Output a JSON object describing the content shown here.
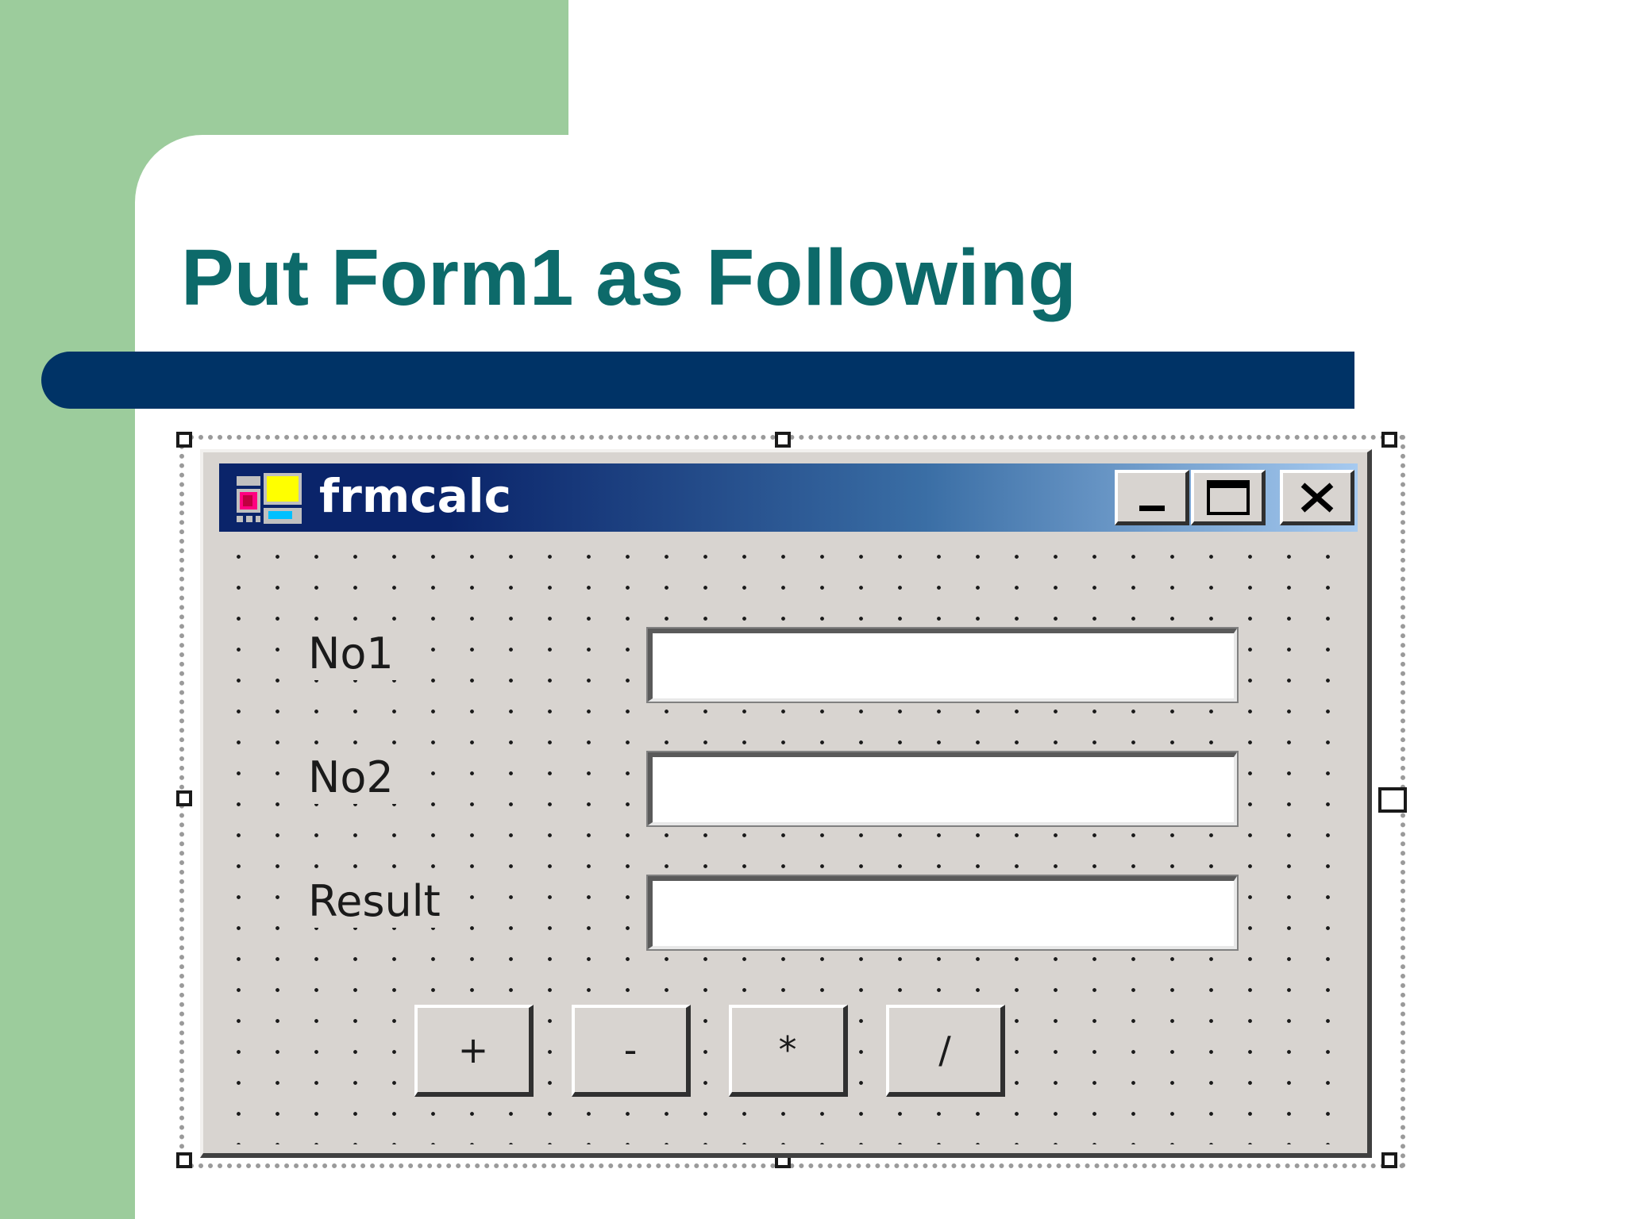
{
  "slide": {
    "title": "Put Form1 as Following"
  },
  "form": {
    "caption": "frmcalc",
    "caption_buttons": [
      {
        "name": "minimize",
        "icon": "minimize-icon"
      },
      {
        "name": "maximize",
        "icon": "maximize-icon"
      },
      {
        "name": "close",
        "icon": "close-icon"
      }
    ],
    "fields": [
      {
        "label": "No1",
        "value": ""
      },
      {
        "label": "No2",
        "value": ""
      },
      {
        "label": "Result",
        "value": ""
      }
    ],
    "buttons": [
      {
        "label": "+"
      },
      {
        "label": "-"
      },
      {
        "label": "*"
      },
      {
        "label": "/"
      }
    ]
  },
  "colors": {
    "title": "#0d6a6a",
    "title_rule": "#003366",
    "side_panel": "#9ccc9c",
    "form_face": "#d8d4d0",
    "caption_start": "#0a246a",
    "caption_end": "#a6caf0"
  }
}
